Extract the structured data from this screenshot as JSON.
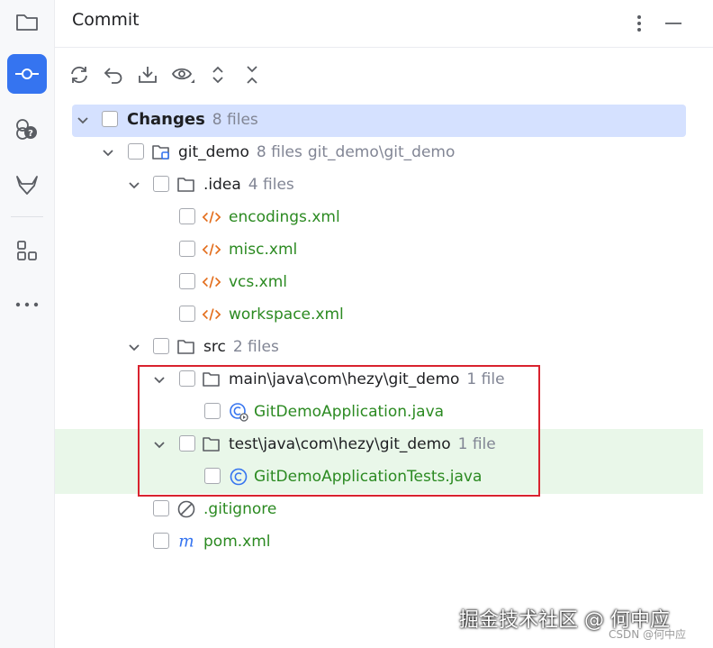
{
  "panel": {
    "title": "Commit"
  },
  "tree": {
    "root": {
      "label": "Changes",
      "count": "8 files"
    },
    "project": {
      "label": "git_demo",
      "count": "8 files",
      "path": "git_demo\\git_demo"
    },
    "idea": {
      "label": ".idea",
      "count": "4 files"
    },
    "idea_files": [
      "encodings.xml",
      "misc.xml",
      "vcs.xml",
      "workspace.xml"
    ],
    "src": {
      "label": "src",
      "count": "2 files"
    },
    "main_pkg": {
      "label": "main\\java\\com\\hezy\\git_demo",
      "count": "1 file"
    },
    "main_file": "GitDemoApplication.java",
    "test_pkg": {
      "label": "test\\java\\com\\hezy\\git_demo",
      "count": "1 file"
    },
    "test_file": "GitDemoApplicationTests.java",
    "gitignore": ".gitignore",
    "pom": "pom.xml"
  },
  "watermark": {
    "main": "掘金技术社区 @ 何中应",
    "sub": "CSDN @何中应"
  },
  "colors": {
    "accent": "#3574f0",
    "selection": "#d5e1ff",
    "highlight": "#e9f7e9",
    "modified": "#2b8a21",
    "xml": "#e36d1b",
    "redbox": "#d9232f"
  }
}
